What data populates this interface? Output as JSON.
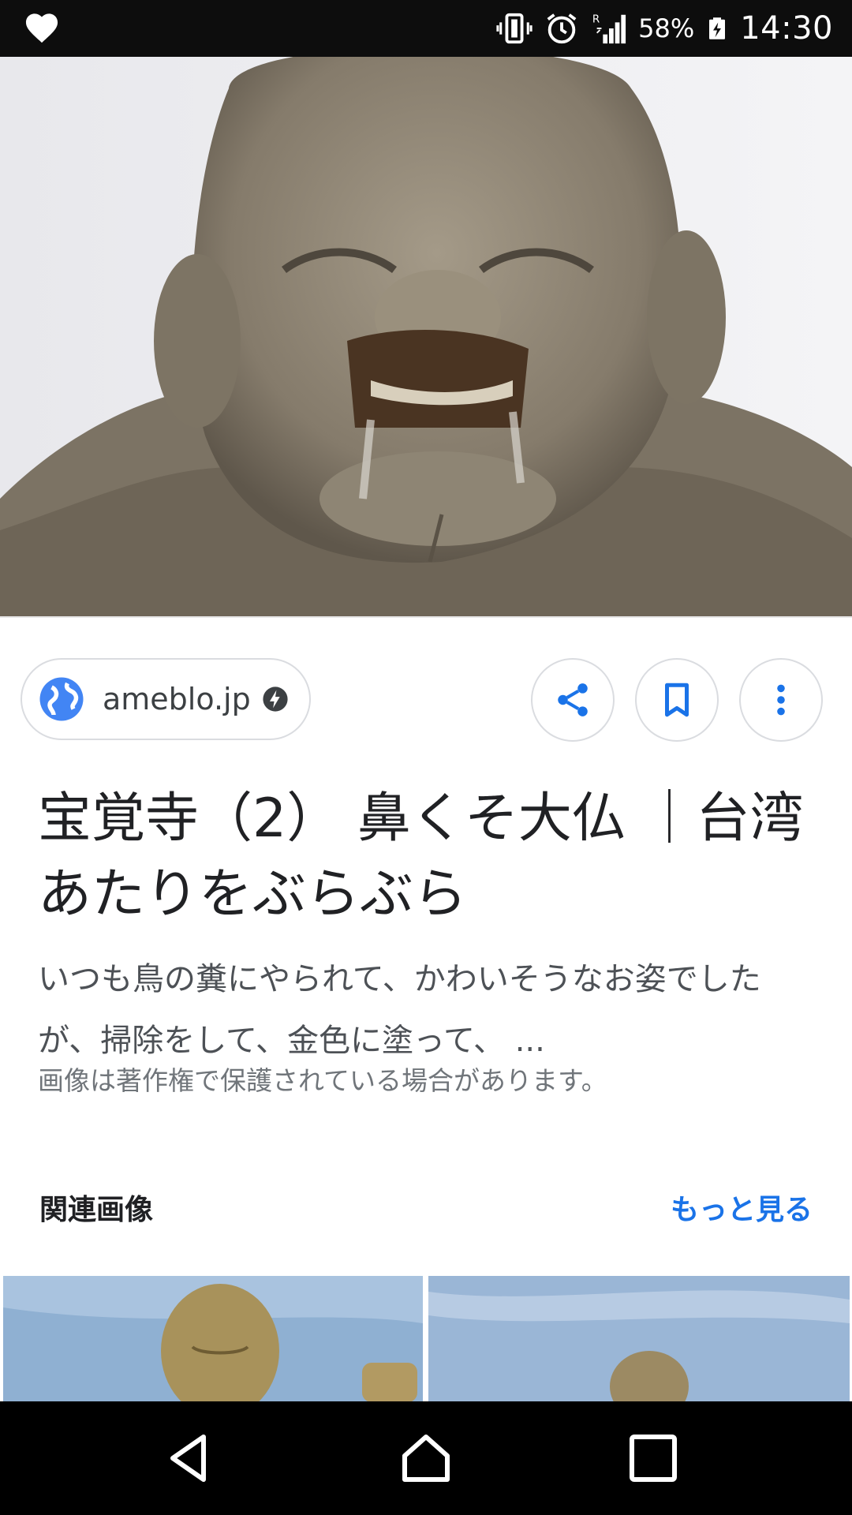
{
  "status_bar": {
    "notification_icon": "heart-icon",
    "icons": [
      "vibrate-icon",
      "alarm-icon",
      "signal-roaming-icon"
    ],
    "battery": "58%",
    "battery_icon": "battery-charging-icon",
    "time": "14:30"
  },
  "result": {
    "image_subject": "stone-buddha-statue",
    "source": {
      "label": "ameblo.jp",
      "icon": "globe-icon",
      "badge_icon": "amp-bolt-icon"
    },
    "actions": [
      "share-icon",
      "bookmark-icon",
      "more-vert-icon"
    ],
    "title": "宝覚寺（2） 鼻くそ大仏 ｜台湾あたりをぶらぶら",
    "snippet": "いつも鳥の糞にやられて、かわいそうなお姿でしたが、掃除をして、金色に塗って、 ...",
    "copyright_notice": "画像は著作権で保護されている場合があります。"
  },
  "related": {
    "heading": "関連画像",
    "more_link": "もっと見る"
  },
  "colors": {
    "accent": "#1a73e8",
    "status_bar_bg": "#0d0d0d",
    "nav_bar_bg": "#000000"
  },
  "nav_bar": {
    "buttons": [
      "back-icon",
      "home-icon",
      "recents-icon"
    ]
  }
}
